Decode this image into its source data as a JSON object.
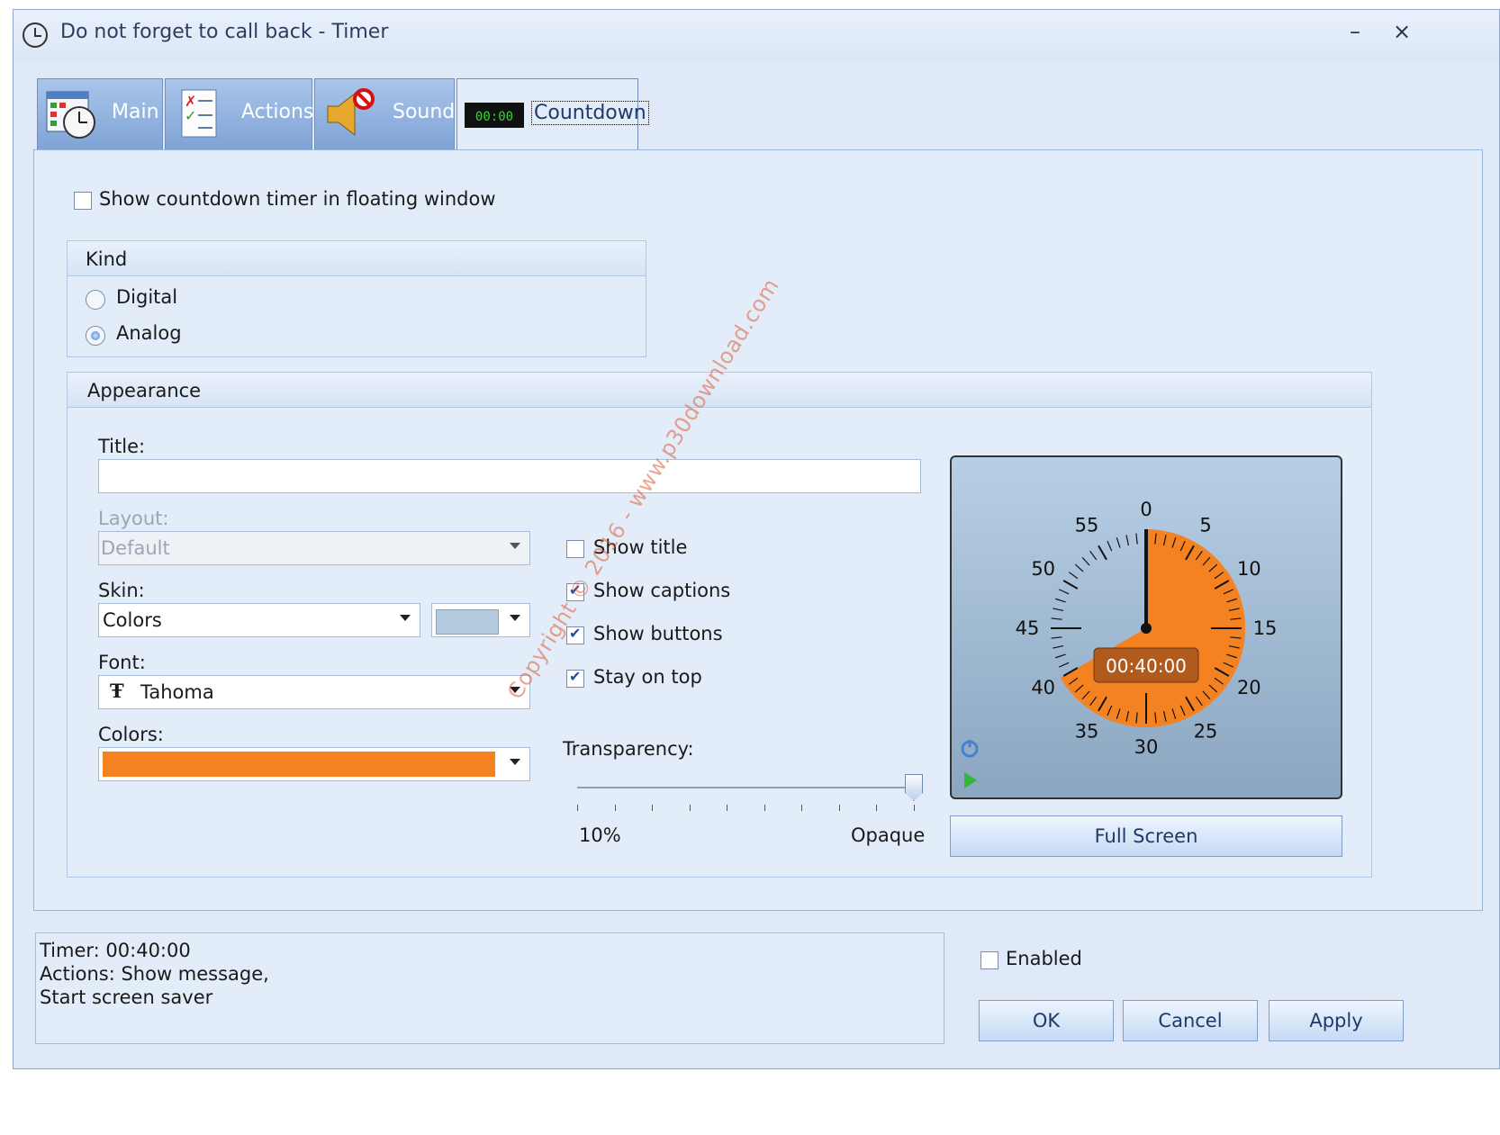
{
  "window": {
    "title": "Do not forget to call back - Timer",
    "minimize_label": "–",
    "close_label": "×"
  },
  "tabs": [
    {
      "label": "Main",
      "icon": "calendar-clock-icon"
    },
    {
      "label": "Actions",
      "icon": "checklist-icon"
    },
    {
      "label": "Sound",
      "icon": "speaker-muted-icon"
    },
    {
      "label": "Countdown",
      "icon": "digital-display-icon",
      "active": true
    }
  ],
  "countdown": {
    "floating_label": "Show countdown timer in floating window",
    "floating_checked": false,
    "kind": {
      "title": "Kind",
      "options": [
        "Digital",
        "Analog"
      ],
      "selected": "Analog"
    },
    "appearance": {
      "title": "Appearance",
      "title_label": "Title:",
      "title_value": "",
      "layout_label": "Layout:",
      "layout_value": "Default",
      "skin_label": "Skin:",
      "skin_value": "Colors",
      "skin_color": "#b4cadf",
      "font_label": "Font:",
      "font_value": "Tahoma",
      "colors_label": "Colors:",
      "colors_value": "#f58220",
      "checks": [
        {
          "label": "Show title",
          "checked": false
        },
        {
          "label": "Show captions",
          "checked": true
        },
        {
          "label": "Show buttons",
          "checked": true
        },
        {
          "label": "Stay on top",
          "checked": true
        }
      ],
      "transparency_label": "Transparency:",
      "transparency_min": "10%",
      "transparency_max": "Opaque",
      "transparency_level": 1.0,
      "dial": {
        "time": "00:40:00",
        "minutes_remaining": 40,
        "labels": [
          "0",
          "5",
          "10",
          "15",
          "20",
          "25",
          "30",
          "35",
          "40",
          "45",
          "50",
          "55"
        ]
      },
      "fullscreen_label": "Full Screen"
    }
  },
  "status": {
    "line1": "Timer: 00:40:00",
    "line2": "Actions: Show message,",
    "line3": "Start screen saver"
  },
  "footer": {
    "enabled_label": "Enabled",
    "enabled_checked": false,
    "ok": "OK",
    "cancel": "Cancel",
    "apply": "Apply"
  },
  "watermark": "Copyright © 2016 - www.p30download.com"
}
